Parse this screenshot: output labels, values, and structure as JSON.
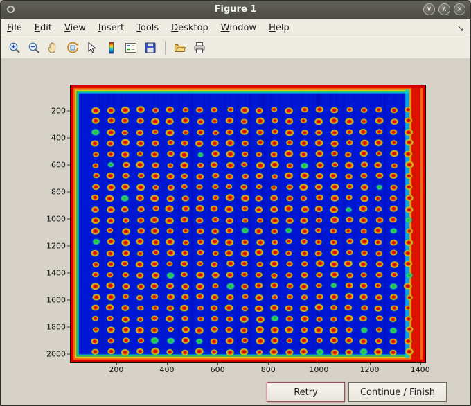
{
  "window": {
    "title": "Figure 1",
    "controls": {
      "minimize": "∨",
      "maximize": "∧",
      "close": "×"
    }
  },
  "menu": {
    "items": [
      {
        "label": "File",
        "accel": "F"
      },
      {
        "label": "Edit",
        "accel": "E"
      },
      {
        "label": "View",
        "accel": "V"
      },
      {
        "label": "Insert",
        "accel": "I"
      },
      {
        "label": "Tools",
        "accel": "T"
      },
      {
        "label": "Desktop",
        "accel": "D"
      },
      {
        "label": "Window",
        "accel": "W"
      },
      {
        "label": "Help",
        "accel": "H"
      }
    ],
    "overflow_icon": "↘"
  },
  "toolbar": {
    "icons": [
      {
        "name": "zoom-in-icon"
      },
      {
        "name": "zoom-out-icon"
      },
      {
        "name": "pan-hand-icon"
      },
      {
        "name": "rotate-3d-icon"
      },
      {
        "name": "data-cursor-icon"
      },
      {
        "name": "insert-colorbar-icon"
      },
      {
        "name": "insert-legend-icon"
      },
      {
        "name": "save-icon"
      },
      {
        "name": "separator"
      },
      {
        "name": "open-folder-icon"
      },
      {
        "name": "print-icon"
      }
    ]
  },
  "buttons": {
    "retry": "Retry",
    "continue_finish": "Continue / Finish"
  },
  "chart_data": {
    "type": "heatmap",
    "title": "",
    "xlabel": "",
    "ylabel": "",
    "xlim": [
      20,
      1420
    ],
    "ylim": [
      10,
      2060
    ],
    "x_ticks": [
      200,
      400,
      600,
      800,
      1000,
      1200,
      1400
    ],
    "y_ticks": [
      200,
      400,
      600,
      800,
      1000,
      1200,
      1400,
      1600,
      1800,
      2000
    ],
    "colormap": "jet",
    "description": "Pseudocolor microarray scan: regular grid of bright red/orange spots with yellow-green halos on a deep blue background; saturated red-orange bands along all four image edges and a bright red vertical band near the right edge.",
    "grid": {
      "rows": 23,
      "cols": 22
    },
    "background_color": "#0017d4",
    "border_band_colors": [
      "#d40000",
      "#ff6a00",
      "#ffd800",
      "#28c850",
      "#00c8d8"
    ],
    "spot_core_color": "#b00000",
    "spot_ring_colors": [
      "#e42000",
      "#ff9800",
      "#e8e000",
      "#3cc83c"
    ],
    "green_spot_fraction": 0.05
  }
}
